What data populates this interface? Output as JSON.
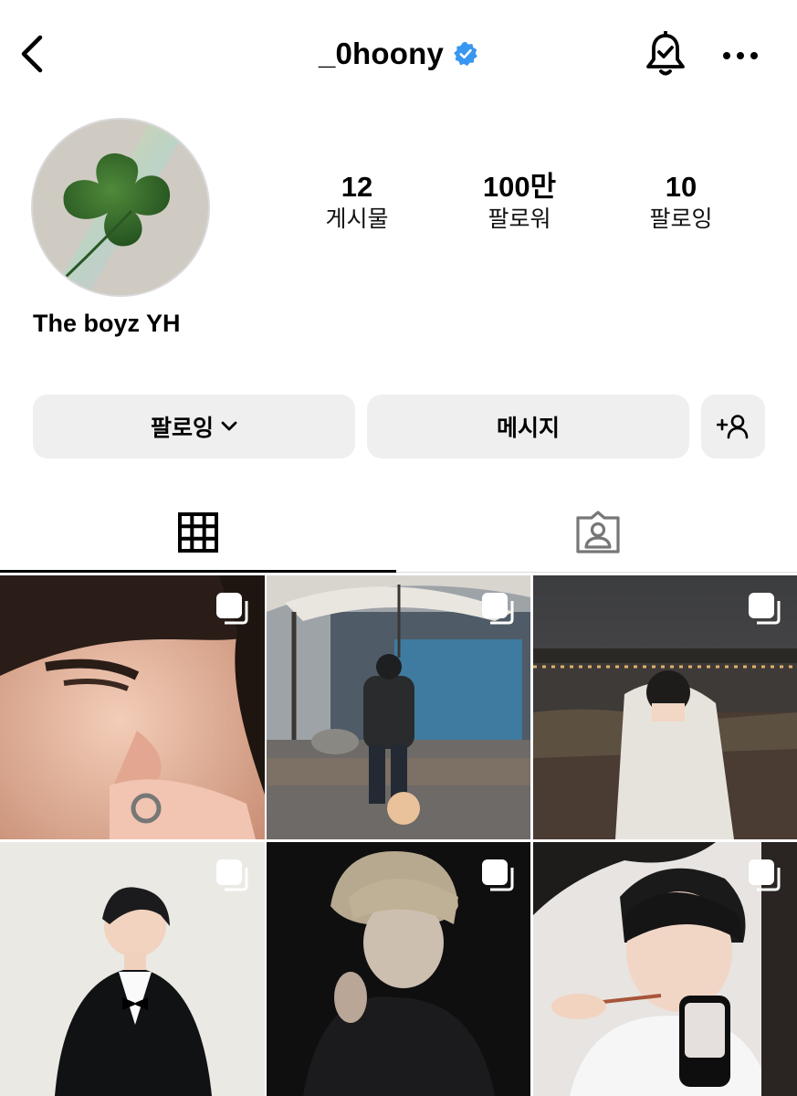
{
  "header": {
    "username": "_0hoony",
    "icons": {
      "back": "chevron-left-icon",
      "verified": "verified-badge-icon",
      "notifications": "bell-check-icon",
      "more": "more-horizontal-icon"
    }
  },
  "profile": {
    "display_name": "The boyz YH",
    "stats": [
      {
        "value": "12",
        "label": "게시물"
      },
      {
        "value": "100만",
        "label": "팔로워"
      },
      {
        "value": "10",
        "label": "팔로잉"
      }
    ]
  },
  "actions": {
    "following_label": "팔로잉",
    "message_label": "메시지",
    "icons": {
      "following_dropdown": "chevron-down-icon",
      "suggest": "add-person-icon"
    }
  },
  "tabs": [
    {
      "name": "posts",
      "icon": "grid-icon",
      "active": true
    },
    {
      "name": "tagged",
      "icon": "tagged-person-icon",
      "active": false
    }
  ],
  "colors": {
    "verified_blue": "#3897f0",
    "button_bg": "#efefef",
    "divider": "#dbdbdb"
  },
  "posts": [
    {
      "type": "carousel",
      "multi": true
    },
    {
      "type": "carousel",
      "multi": true
    },
    {
      "type": "carousel",
      "multi": true
    },
    {
      "type": "carousel",
      "multi": true
    },
    {
      "type": "carousel",
      "multi": true
    },
    {
      "type": "carousel",
      "multi": true
    }
  ]
}
